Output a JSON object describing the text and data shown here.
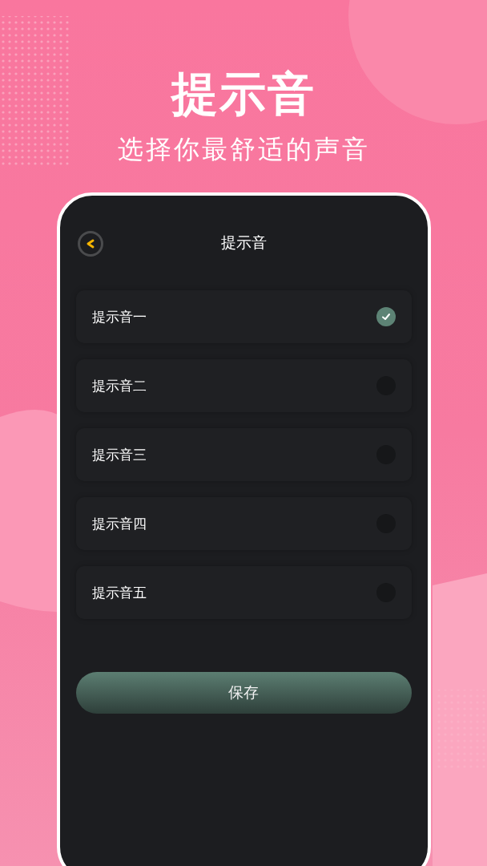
{
  "headline": "提示音",
  "subtitle": "选择你最舒适的声音",
  "screen": {
    "title": "提示音",
    "options": [
      {
        "label": "提示音一",
        "selected": true
      },
      {
        "label": "提示音二",
        "selected": false
      },
      {
        "label": "提示音三",
        "selected": false
      },
      {
        "label": "提示音四",
        "selected": false
      },
      {
        "label": "提示音五",
        "selected": false
      }
    ],
    "button": "保存"
  }
}
